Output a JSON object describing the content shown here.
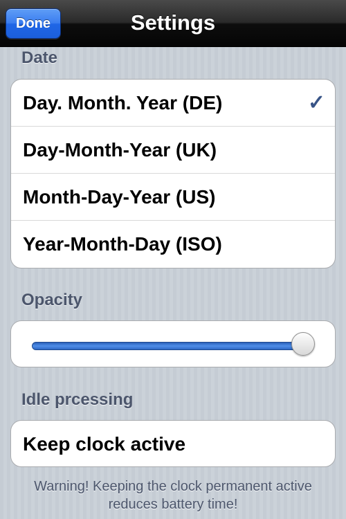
{
  "navbar": {
    "title": "Settings",
    "done_label": "Done"
  },
  "date_section": {
    "header": "Date",
    "options": [
      {
        "label": "Day. Month. Year (DE)",
        "selected": true
      },
      {
        "label": "Day-Month-Year (UK)",
        "selected": false
      },
      {
        "label": "Month-Day-Year (US)",
        "selected": false
      },
      {
        "label": "Year-Month-Day (ISO)",
        "selected": false
      }
    ],
    "checkmark": "✓"
  },
  "opacity_section": {
    "header": "Opacity",
    "slider_value": 1.0
  },
  "idle_section": {
    "header": "Idle prcessing",
    "row_label": "Keep clock active",
    "warning": "Warning! Keeping the clock permanent active reduces battery time!"
  },
  "colors": {
    "accent": "#385487",
    "button": "#3b7ef0",
    "header_text": "#4c566c"
  }
}
